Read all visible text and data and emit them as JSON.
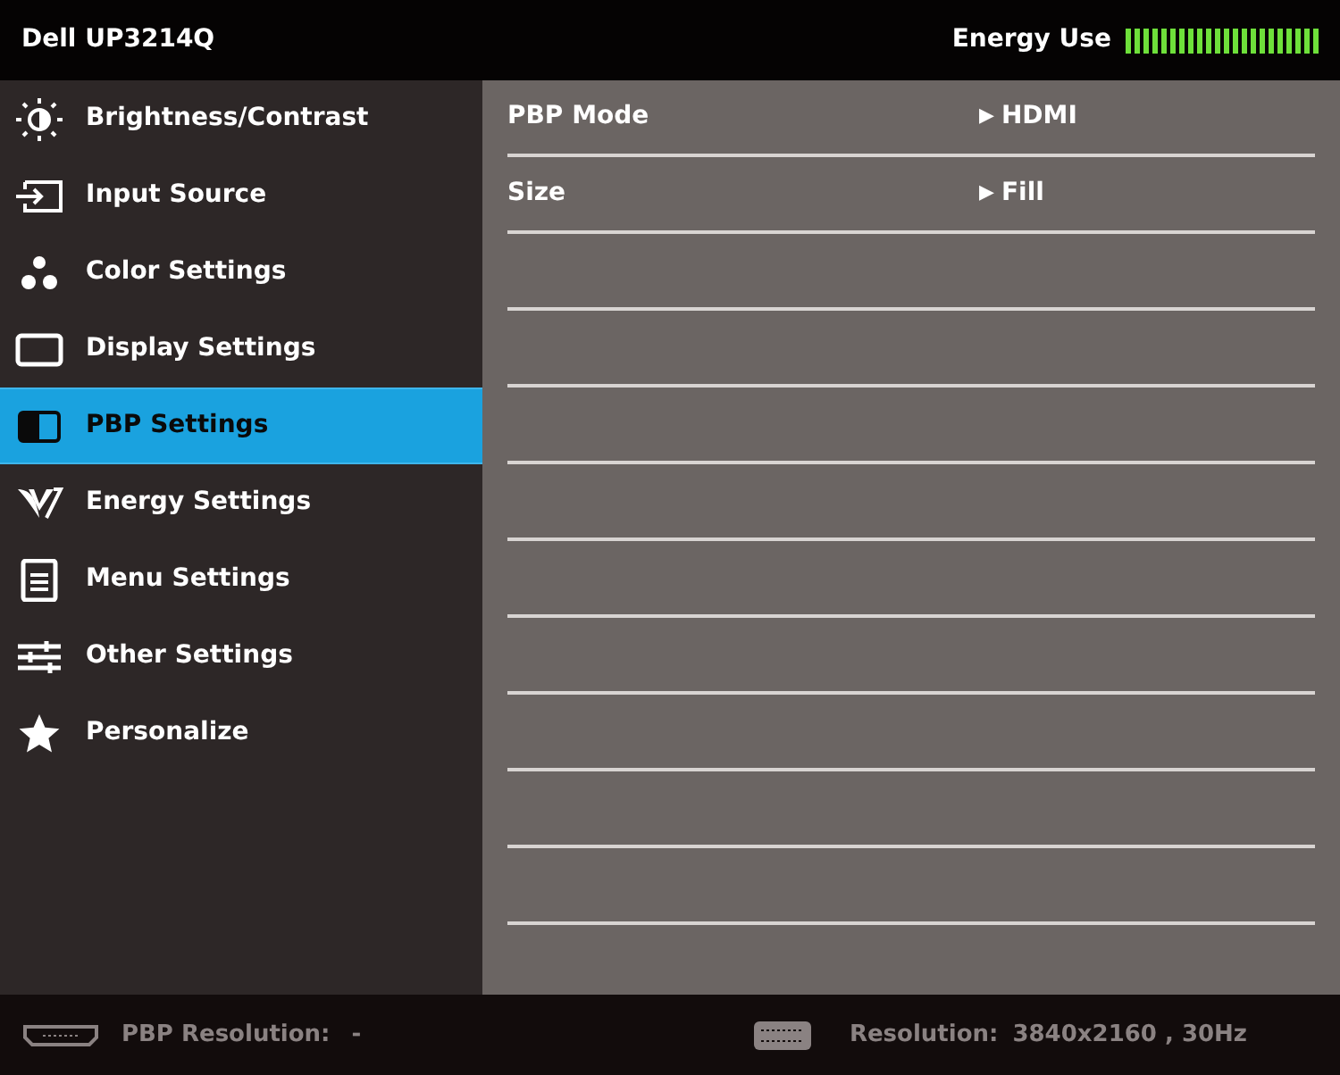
{
  "header": {
    "title": "Dell UP3214Q",
    "energy_label": "Energy Use",
    "energy_meter": {
      "level": 1
    }
  },
  "menu": [
    {
      "kind": "brightness",
      "label": "Brightness/Contrast",
      "selected": false
    },
    {
      "kind": "input",
      "label": "Input Source",
      "selected": false
    },
    {
      "kind": "color",
      "label": "Color Settings",
      "selected": false
    },
    {
      "kind": "display",
      "label": "Display Settings",
      "selected": false
    },
    {
      "kind": "pbp",
      "label": "PBP Settings",
      "selected": true
    },
    {
      "kind": "energy",
      "label": "Energy Settings",
      "selected": false
    },
    {
      "kind": "menu",
      "label": "Menu Settings",
      "selected": false
    },
    {
      "kind": "other",
      "label": "Other Settings",
      "selected": false
    },
    {
      "kind": "personalize",
      "label": "Personalize",
      "selected": false
    }
  ],
  "settings": [
    {
      "label": "PBP Mode",
      "marker": "▶",
      "value": "HDMI"
    },
    {
      "label": "Size",
      "marker": "▶",
      "value": "Fill"
    }
  ],
  "footer": {
    "pbp_label": "PBP Resolution:",
    "pbp_value": "-",
    "res_label": "Resolution:",
    "res_value": "3840x2160 , 30Hz"
  }
}
